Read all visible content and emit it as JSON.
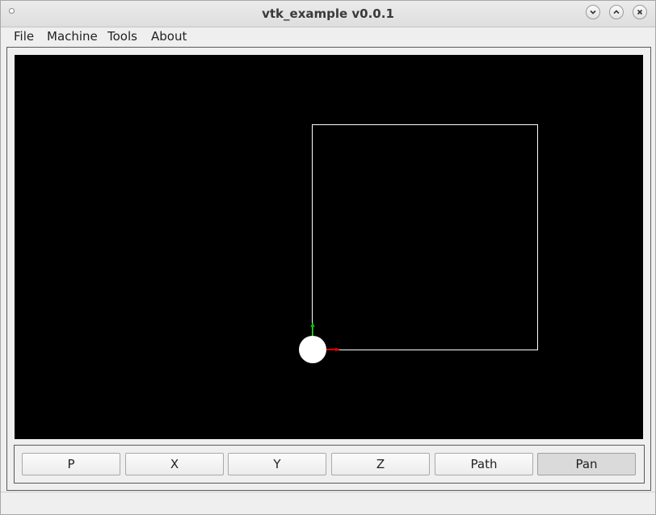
{
  "window": {
    "title": "vtk_example v0.0.1"
  },
  "menubar": {
    "items": [
      "File",
      "Machine",
      "Tools",
      "About"
    ]
  },
  "viewport": {
    "background": "#000000",
    "path_color": "#ffffff",
    "tool_color": "#ffffff",
    "axis_x_color": "#e00000",
    "axis_y_color": "#00c800"
  },
  "toolbar": {
    "buttons": [
      "P",
      "X",
      "Y",
      "Z",
      "Path",
      "Pan"
    ],
    "pressed": "Pan"
  },
  "icons": {
    "collapse": "chevron-down-icon",
    "restore": "chevron-up-icon",
    "close": "close-icon"
  }
}
